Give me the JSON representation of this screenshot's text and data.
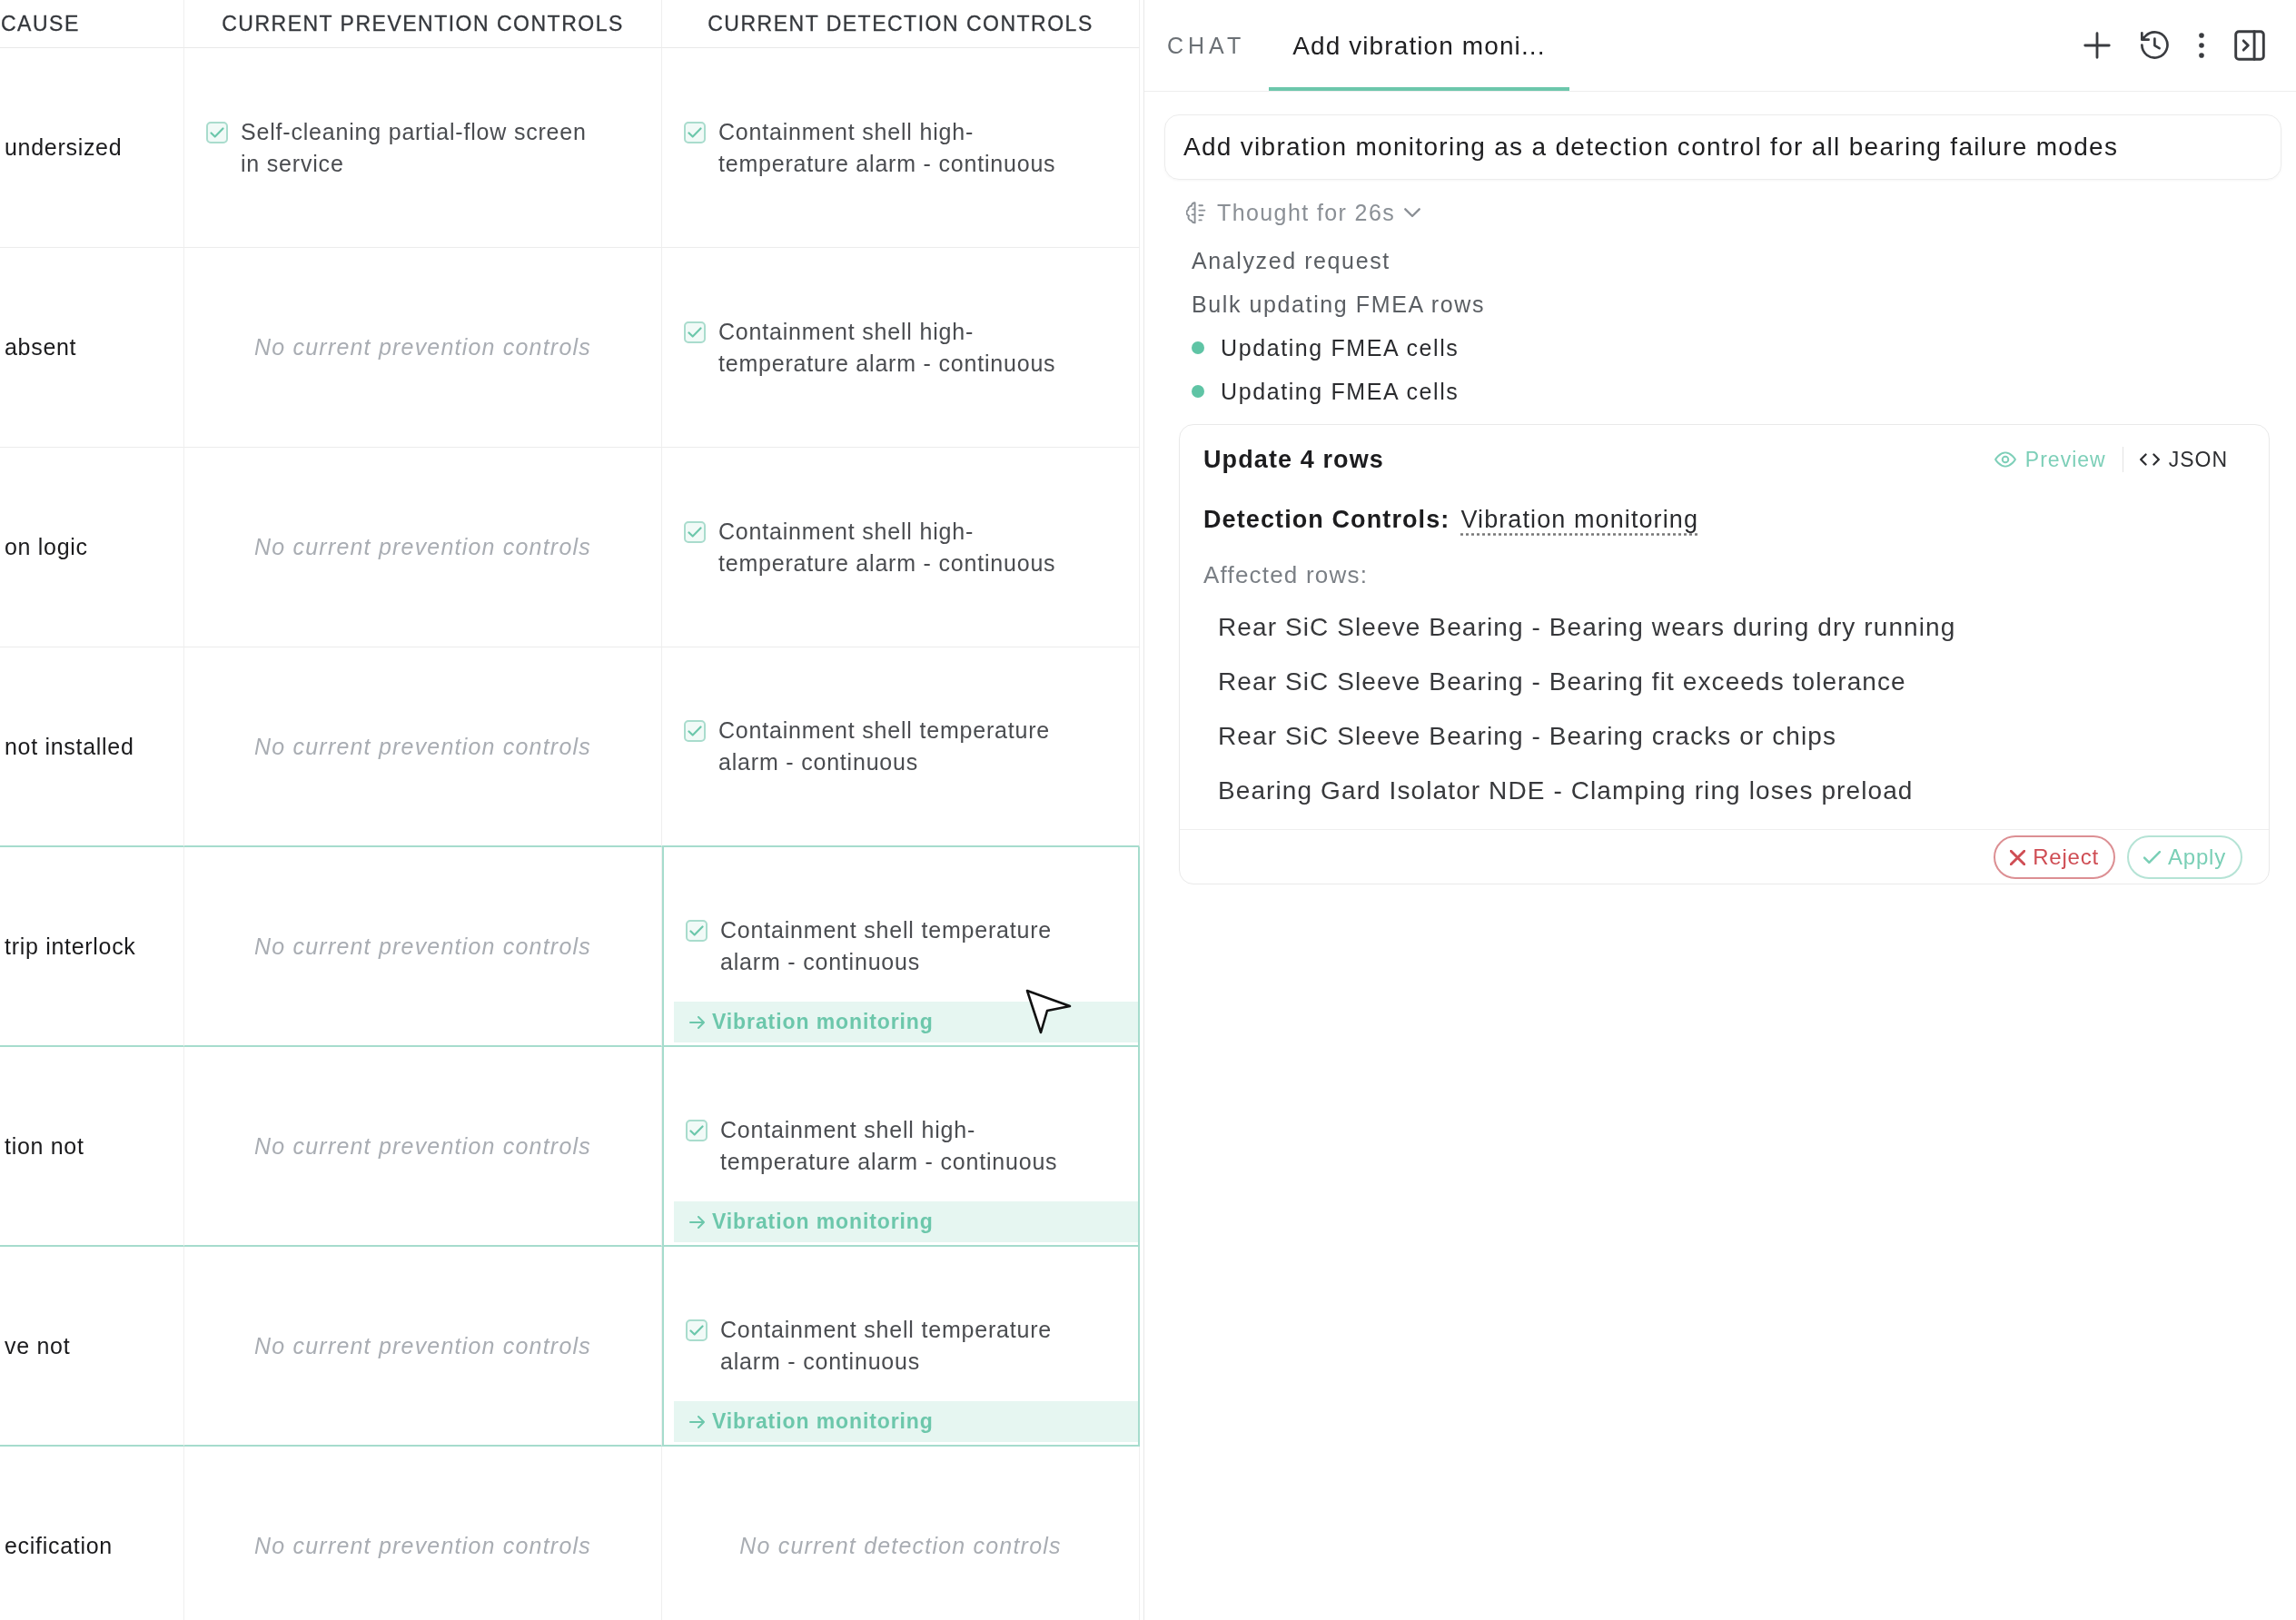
{
  "table": {
    "columns": [
      "CAUSE",
      "CURRENT PREVENTION CONTROLS",
      "CURRENT DETECTION CONTROLS"
    ],
    "rows": [
      {
        "cause": "undersized",
        "highlighted": false,
        "prevention": {
          "controls": [
            {
              "text": "Self-cleaning partial-flow screen in service",
              "checked": true
            }
          ]
        },
        "detection": {
          "controls": [
            {
              "text": "Containment shell high-temperature alarm - continuous",
              "checked": true
            }
          ]
        }
      },
      {
        "cause": "absent",
        "highlighted": false,
        "prevention": {
          "empty_text": "No current prevention controls"
        },
        "detection": {
          "controls": [
            {
              "text": "Containment shell high-temperature alarm - continuous",
              "checked": true
            }
          ]
        }
      },
      {
        "cause": "on logic",
        "highlighted": false,
        "prevention": {
          "empty_text": "No current prevention controls"
        },
        "detection": {
          "controls": [
            {
              "text": "Containment shell high-temperature alarm - continuous",
              "checked": true
            }
          ]
        }
      },
      {
        "cause": "not installed",
        "highlighted": false,
        "prevention": {
          "empty_text": "No current prevention controls"
        },
        "detection": {
          "controls": [
            {
              "text": "Containment shell temperature alarm - continuous",
              "checked": true
            }
          ]
        }
      },
      {
        "cause": "trip interlock",
        "highlighted": true,
        "prevention": {
          "empty_text": "No current prevention controls"
        },
        "detection": {
          "controls": [
            {
              "text": "Containment shell temperature alarm - continuous",
              "checked": true
            }
          ],
          "proposed": "Vibration monitoring"
        }
      },
      {
        "cause": "tion not",
        "highlighted": true,
        "prevention": {
          "empty_text": "No current prevention controls"
        },
        "detection": {
          "controls": [
            {
              "text": "Containment shell high-temperature alarm - continuous",
              "checked": true
            }
          ],
          "proposed": "Vibration monitoring"
        }
      },
      {
        "cause": "ve not",
        "highlighted": true,
        "prevention": {
          "empty_text": "No current prevention controls"
        },
        "detection": {
          "controls": [
            {
              "text": "Containment shell temperature alarm - continuous",
              "checked": true
            }
          ],
          "proposed": "Vibration monitoring"
        }
      },
      {
        "cause": "ecification",
        "highlighted": false,
        "prevention": {
          "empty_text": "No current prevention controls"
        },
        "detection": {
          "empty_text": "No current detection controls"
        }
      }
    ]
  },
  "chat": {
    "label": "CHAT",
    "tabs": [
      {
        "label": "Add vibration moni...",
        "selected": true
      }
    ],
    "message": "Add vibration monitoring as a detection control for all bearing failure modes",
    "thought": {
      "label": "Thought for 26s",
      "expanded": true
    },
    "steps": [
      {
        "kind": "plain",
        "text": "Analyzed request"
      },
      {
        "kind": "plain",
        "text": "Bulk updating FMEA rows"
      },
      {
        "kind": "dot",
        "text": "Updating FMEA cells"
      },
      {
        "kind": "dot",
        "text": "Updating FMEA cells"
      }
    ],
    "proposal": {
      "title": "Update 4 rows",
      "views": [
        {
          "kind": "preview",
          "label": "Preview",
          "selected": true
        },
        {
          "kind": "code",
          "label": "JSON",
          "selected": false
        }
      ],
      "field_label": "Detection Controls:",
      "field_value": "Vibration monitoring",
      "affected_label": "Affected rows:",
      "affected_rows": [
        "Rear SiC Sleeve Bearing - Bearing wears during dry running",
        "Rear SiC Sleeve Bearing - Bearing fit exceeds tolerance",
        "Rear SiC Sleeve Bearing - Bearing cracks or chips",
        "Bearing Gard Isolator NDE - Clamping ring loses preload"
      ],
      "actions": [
        {
          "kind": "reject",
          "label": "Reject"
        },
        {
          "kind": "apply",
          "label": "Apply"
        }
      ]
    }
  }
}
